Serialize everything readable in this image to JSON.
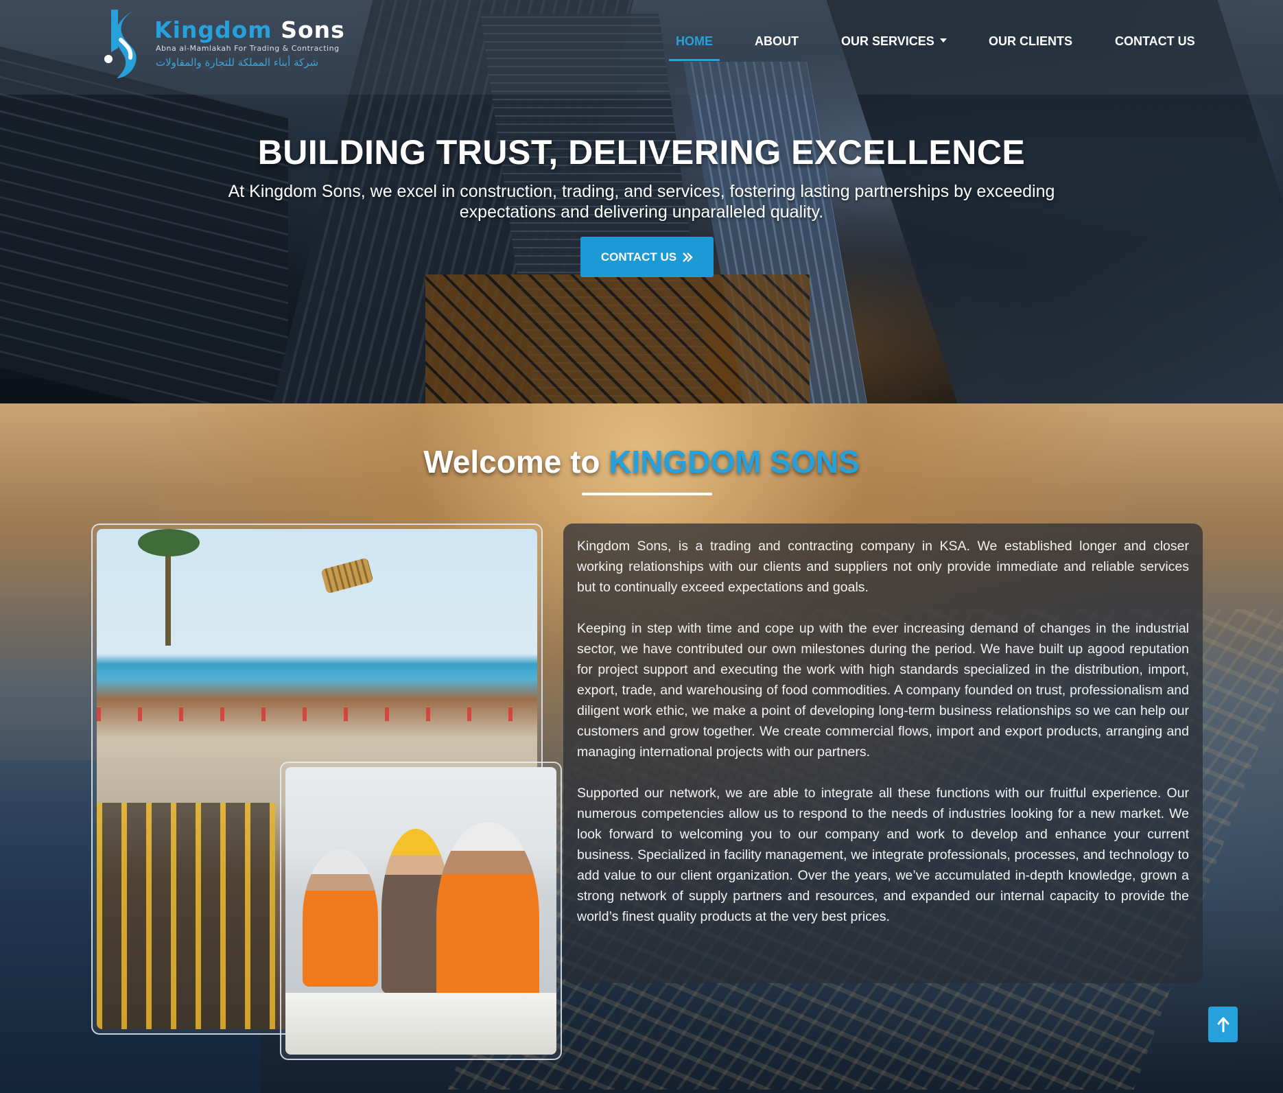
{
  "brand": {
    "name_part1": "Kingdom",
    "name_part2": "Sons",
    "tagline": "Abna al-Mamlakah For Trading & Contracting",
    "arabic_name": "شركة أبناء المملكة للتجارة والمقاولات",
    "colors": {
      "accent": "#27a1dc",
      "button": "#1c9ad6"
    }
  },
  "nav": {
    "items": [
      {
        "label": "HOME",
        "active": true
      },
      {
        "label": "ABOUT",
        "active": false
      },
      {
        "label": "OUR SERVICES",
        "active": false,
        "has_dropdown": true
      },
      {
        "label": "OUR CLIENTS",
        "active": false
      },
      {
        "label": "CONTACT US",
        "active": false
      }
    ]
  },
  "hero": {
    "title": "BUILDING TRUST, DELIVERING EXCELLENCE",
    "subtitle": "At Kingdom Sons, we excel in construction, trading, and services, fostering lasting partnerships by exceeding expectations and delivering unparalleled quality.",
    "cta_label": "CONTACT US",
    "cta_icon": "double-chevron-right-icon"
  },
  "about": {
    "heading_prefix": "Welcome to",
    "heading_highlight": "KINGDOM SONS",
    "paragraphs": [
      "Kingdom Sons, is a trading and contracting company in KSA. We established longer and closer working relationships with our clients and suppliers not only provide immediate and reliable services but to continually exceed expectations and goals.",
      "Keeping in step with time and cope up with the ever increasing demand of changes in the industrial sector, we have contributed our own milestones during the period. We have built up agood reputation for project support and executing the work with high standards specialized in the distribution, import, export, trade, and warehousing of food commodities. A company founded on trust, professionalism and diligent work ethic, we make a point of developing long-term business relationships so we can help our customers and grow together. We create commercial flows, import and export products, arranging and managing international projects with our partners.",
      "Supported our network, we are able to integrate all these functions with our fruitful experience. Our numerous competencies allow us to respond to the needs of industries looking for a new market. We look forward to welcoming you to our company and work to develop and enhance your current business. Specialized in facility management, we integrate professionals, processes, and technology to add value to our client organization. Over the years, we’ve accumulated in-depth knowledge, grown a strong network of supply partners and resources, and expanded our internal capacity to provide the world’s finest quality products at the very best prices."
    ]
  },
  "scroll_top": {
    "icon": "arrow-up-icon"
  }
}
